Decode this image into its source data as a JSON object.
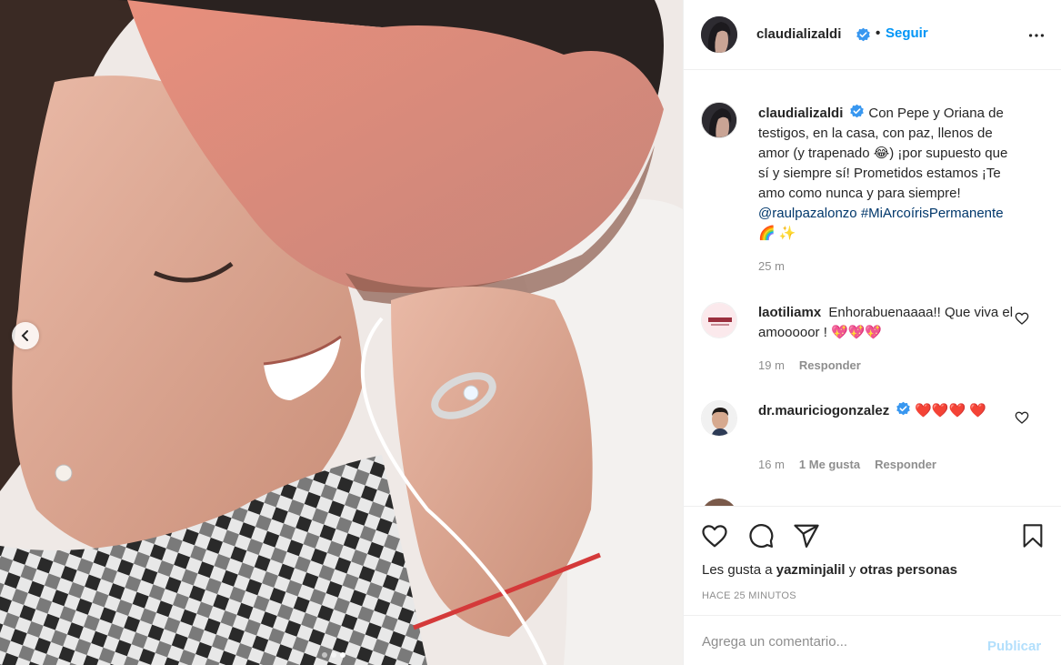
{
  "post": {
    "photo": {
      "alt_icon": "photo",
      "slide_count": 3,
      "active_slide": 3
    },
    "header": {
      "username": "claudializaldi",
      "separator": "•",
      "follow_label": "Seguir",
      "more_icon": "more-horizontal-icon"
    },
    "caption": {
      "username": "claudializaldi",
      "text": "Con Pepe y Oriana de testigos, en la casa, con paz, llenos de amor (y trapenado 😂) ¡por supuesto que sí y siempre sí! Prometidos estamos ¡Te amo como nunca y para siempre!",
      "mention": "@raulpazalonzo",
      "hashtag": "#MiArcoírisPermanente",
      "emojis": "🌈 ✨",
      "time": "25 m"
    },
    "comments": [
      {
        "username": "laotiliamx",
        "text": "Enhorabuenaaaa!! Que viva el amooooor ! 💖💖💖",
        "time": "19 m",
        "likes": "",
        "reply_label": "Responder"
      },
      {
        "username": "dr.mauriciogonzalez",
        "text": "❤️❤️❤️ ❤️",
        "time": "16 m",
        "likes": "1 Me gusta",
        "reply_label": "Responder"
      }
    ],
    "actions": {
      "likes_prefix": "Les gusta a",
      "likes_user": "yazminjalil",
      "likes_and": "y",
      "likes_others": "otras personas",
      "timestamp": "HACE 25 MINUTOS"
    },
    "add_comment": {
      "placeholder": "Agrega un comentario...",
      "publish_label": "Publicar"
    },
    "colors": {
      "accent": "#0095f6",
      "verified": "#3897f0",
      "publish_disabled": "#b2dffc",
      "muted": "#8e8e8e"
    }
  }
}
